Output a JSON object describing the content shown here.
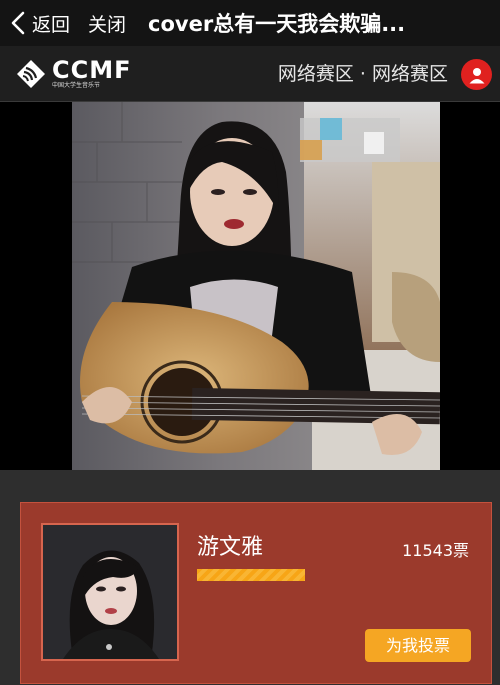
{
  "navbar": {
    "back_label": "返回",
    "close_label": "关闭",
    "title": "cover总有一天我会欺骗..."
  },
  "header": {
    "logo_text": "CCMF",
    "logo_subtitle": "中国大学生音乐节",
    "zone_label": "网络赛区 · 网络赛区",
    "user_icon": "user-icon"
  },
  "candidate": {
    "name": "游文雅",
    "votes": "11543票",
    "vote_button_label": "为我投票",
    "progress": 0.35
  },
  "colors": {
    "accent_red": "#e0211f",
    "card_bg": "#9b3a2c",
    "vote_orange": "#f5a623"
  }
}
